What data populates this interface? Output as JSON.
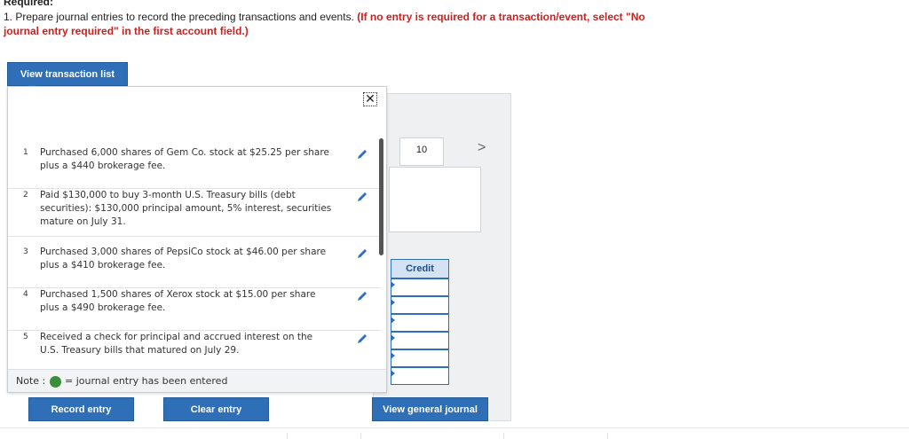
{
  "header": {
    "title": "Required:",
    "line1_prefix": "1. Prepare journal entries to record the preceding transactions and events.",
    "line1_red": "(If no entry is required for a transaction/event, select \"No",
    "line2_red": "journal entry required\" in the first account field.)"
  },
  "buttons": {
    "view_transaction_list": "View transaction list",
    "record_entry": "Record entry",
    "clear_entry": "Clear entry",
    "view_general_journal": "View general journal"
  },
  "popup": {
    "close_symbol": "✕",
    "transactions": [
      {
        "num": "1",
        "text": "Purchased 6,000 shares of Gem Co. stock at $25.25 per share plus a $440 brokerage fee."
      },
      {
        "num": "2",
        "text": "Paid $130,000 to buy 3-month U.S. Treasury bills (debt securities): $130,000 principal amount, 5% interest, securities mature on July 31."
      },
      {
        "num": "3",
        "text": "Purchased 3,000 shares of PepsiCo stock at $46.00 per share plus a $410 brokerage fee."
      },
      {
        "num": "4",
        "text": "Purchased 1,500 shares of Xerox stock at $15.00 per share plus a $490 brokerage fee."
      },
      {
        "num": "5",
        "text": "Received a check for principal and accrued interest on the U.S. Treasury bills that matured on July 29."
      }
    ],
    "note_label": "Note :",
    "note_text": "= journal entry has been entered"
  },
  "journal": {
    "entry_number": "10",
    "next_symbol": ">",
    "credit_header": "Credit"
  },
  "colors": {
    "accent": "#2e6fb7",
    "red": "#cc1f1f",
    "entered_dot": "#3c8d3c"
  }
}
